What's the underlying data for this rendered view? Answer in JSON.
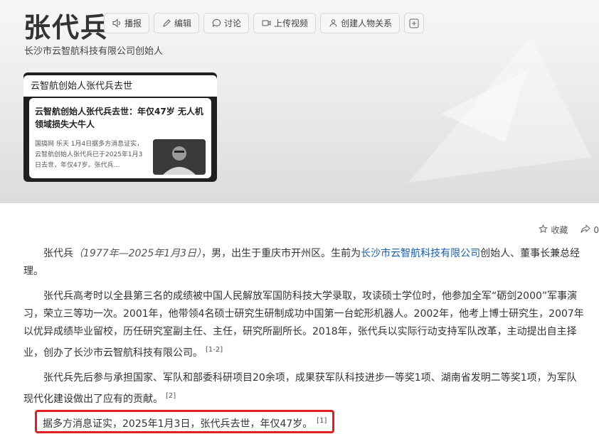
{
  "header": {
    "name": "张代兵",
    "subtitle": "长沙市云智航科技有限公司创始人",
    "toolbar": [
      {
        "label": "播报",
        "icon": "speaker-icon"
      },
      {
        "label": "编辑",
        "icon": "edit-icon"
      },
      {
        "label": "讨论",
        "icon": "chat-icon"
      },
      {
        "label": "上传视频",
        "icon": "video-icon"
      },
      {
        "label": "创建人物关系",
        "icon": "relation-icon"
      },
      {
        "label": "",
        "icon": "plus-icon"
      }
    ]
  },
  "news_card": {
    "heading": "云智航创始人张代兵去世",
    "title": "云智航创始人张代兵去世：年仅47岁 无人机领域损失大牛人",
    "snippet": "国搞网 乐天 1月4日据多方消息证实，云智航创始人张代兵已于2025年1月3日去世，年仅47岁。张代兵…"
  },
  "actions": {
    "collect": "收藏",
    "share_count": "0"
  },
  "content": {
    "p1_name": "张代兵",
    "p1_dates": "（1977年—2025年1月3日）",
    "p1_mid": "，男，出生于重庆市开州区。生前为",
    "p1_link": "长沙市云智航科技有限公司",
    "p1_end": "创始人、董事长兼总经理。",
    "p2": "张代兵高考时以全县第三名的成绩被中国人民解放军国防科技大学录取，攻读硕士学位时，他参加全军“砺剑2000”军事演习，荣立三等功一次。2001年，他带领4名硕士研究生研制成功中国第一台蛇形机器人。2002年，他考上博士研究生，2007年以优异成绩毕业留校，历任研究室副主任、主任，研究所副所长。2018年，张代兵以实际行动支持军队改革，主动提出自主择业，创办了长沙市云智航科技有限公司。",
    "p2_ref": "[1-2]",
    "p3": "张代兵先后参与承担国家、军队和部委科研项目20余项，成果获军队科技进步一等奖1项、湖南省发明二等奖1项，为军队现代化建设做出了应有的贡献。",
    "p3_ref": "[2]",
    "p4": "据多方消息证实，2025年1月3日，张代兵去世，年仅47岁。",
    "p4_ref": "[1]"
  }
}
